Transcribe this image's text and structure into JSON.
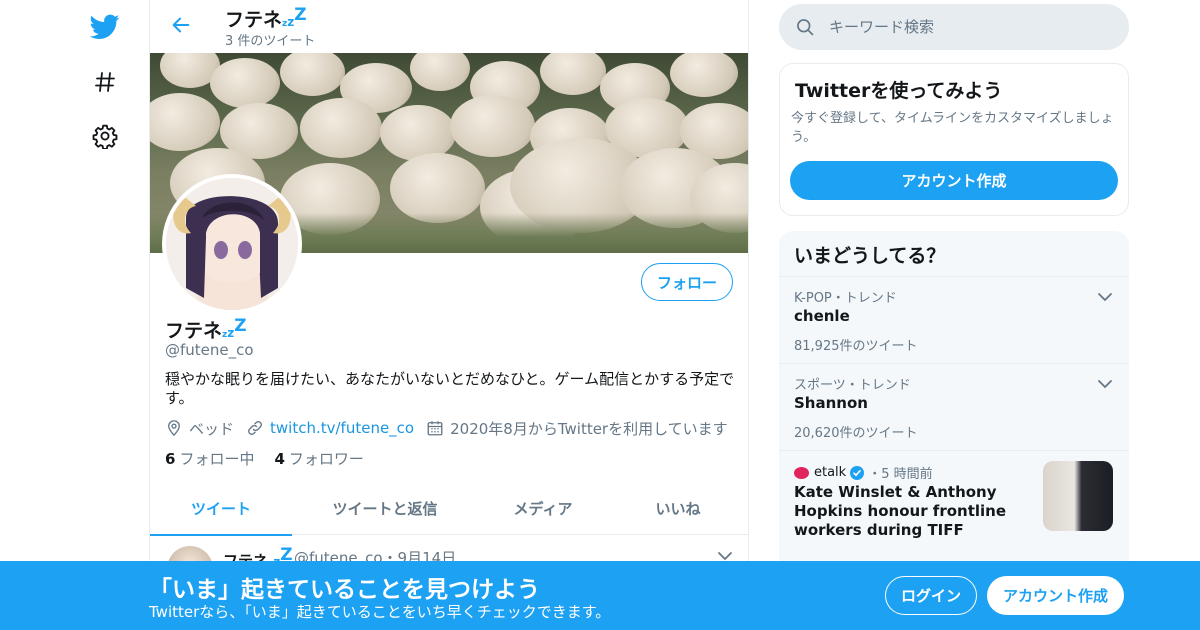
{
  "nav": {
    "icons": [
      "twitter-bird-icon",
      "hashtag-icon",
      "settings-gear-icon"
    ]
  },
  "header": {
    "name": "フテネ",
    "name_suffix": "zzZ",
    "tweet_count": "3 件のツイート"
  },
  "profile": {
    "name": "フテネ",
    "handle": "@futene_co",
    "bio": "穏やかな眠りを届けたい、あなたがいないとだめなひと。ゲーム配信とかする予定です。",
    "location": "ベッド",
    "link": "twitch.tv/futene_co",
    "joined": "2020年8月からTwitterを利用しています",
    "following_count": "6",
    "following_label": "フォロー中",
    "followers_count": "4",
    "followers_label": "フォロワー",
    "follow_button": "フォロー"
  },
  "tabs": [
    "ツイート",
    "ツイートと返信",
    "メディア",
    "いいね"
  ],
  "active_tab": "ツイート",
  "tweet": {
    "name": "フテネ",
    "meta": "@futene_co・9月14日"
  },
  "search": {
    "placeholder": "キーワード検索"
  },
  "signup_card": {
    "title": "Twitterを使ってみよう",
    "text": "今すぐ登録して、タイムラインをカスタマイズしましょう。",
    "button": "アカウント作成"
  },
  "trends": {
    "title": "いまどうしてる？",
    "items": [
      {
        "meta": "K-POP・トレンド",
        "name": "chenle",
        "count": "81,925件のツイート"
      },
      {
        "meta": "スポーツ・トレンド",
        "name": "Shannon",
        "count": "20,620件のツイート"
      }
    ],
    "news": {
      "source": "etalk",
      "time": "・5 時間前",
      "title": "Kate Winslet & Anthony Hopkins honour frontline workers during TIFF"
    }
  },
  "bottom_bar": {
    "title": "「いま」起きていることを見つけよう",
    "subtitle": "Twitterなら、「いま」起きていることをいち早くチェックできます。",
    "login": "ログイン",
    "signup": "アカウント作成"
  },
  "colors": {
    "accent": "#1da1f2",
    "text": "#14171a",
    "muted": "#657786",
    "border": "#e6ecf0"
  }
}
